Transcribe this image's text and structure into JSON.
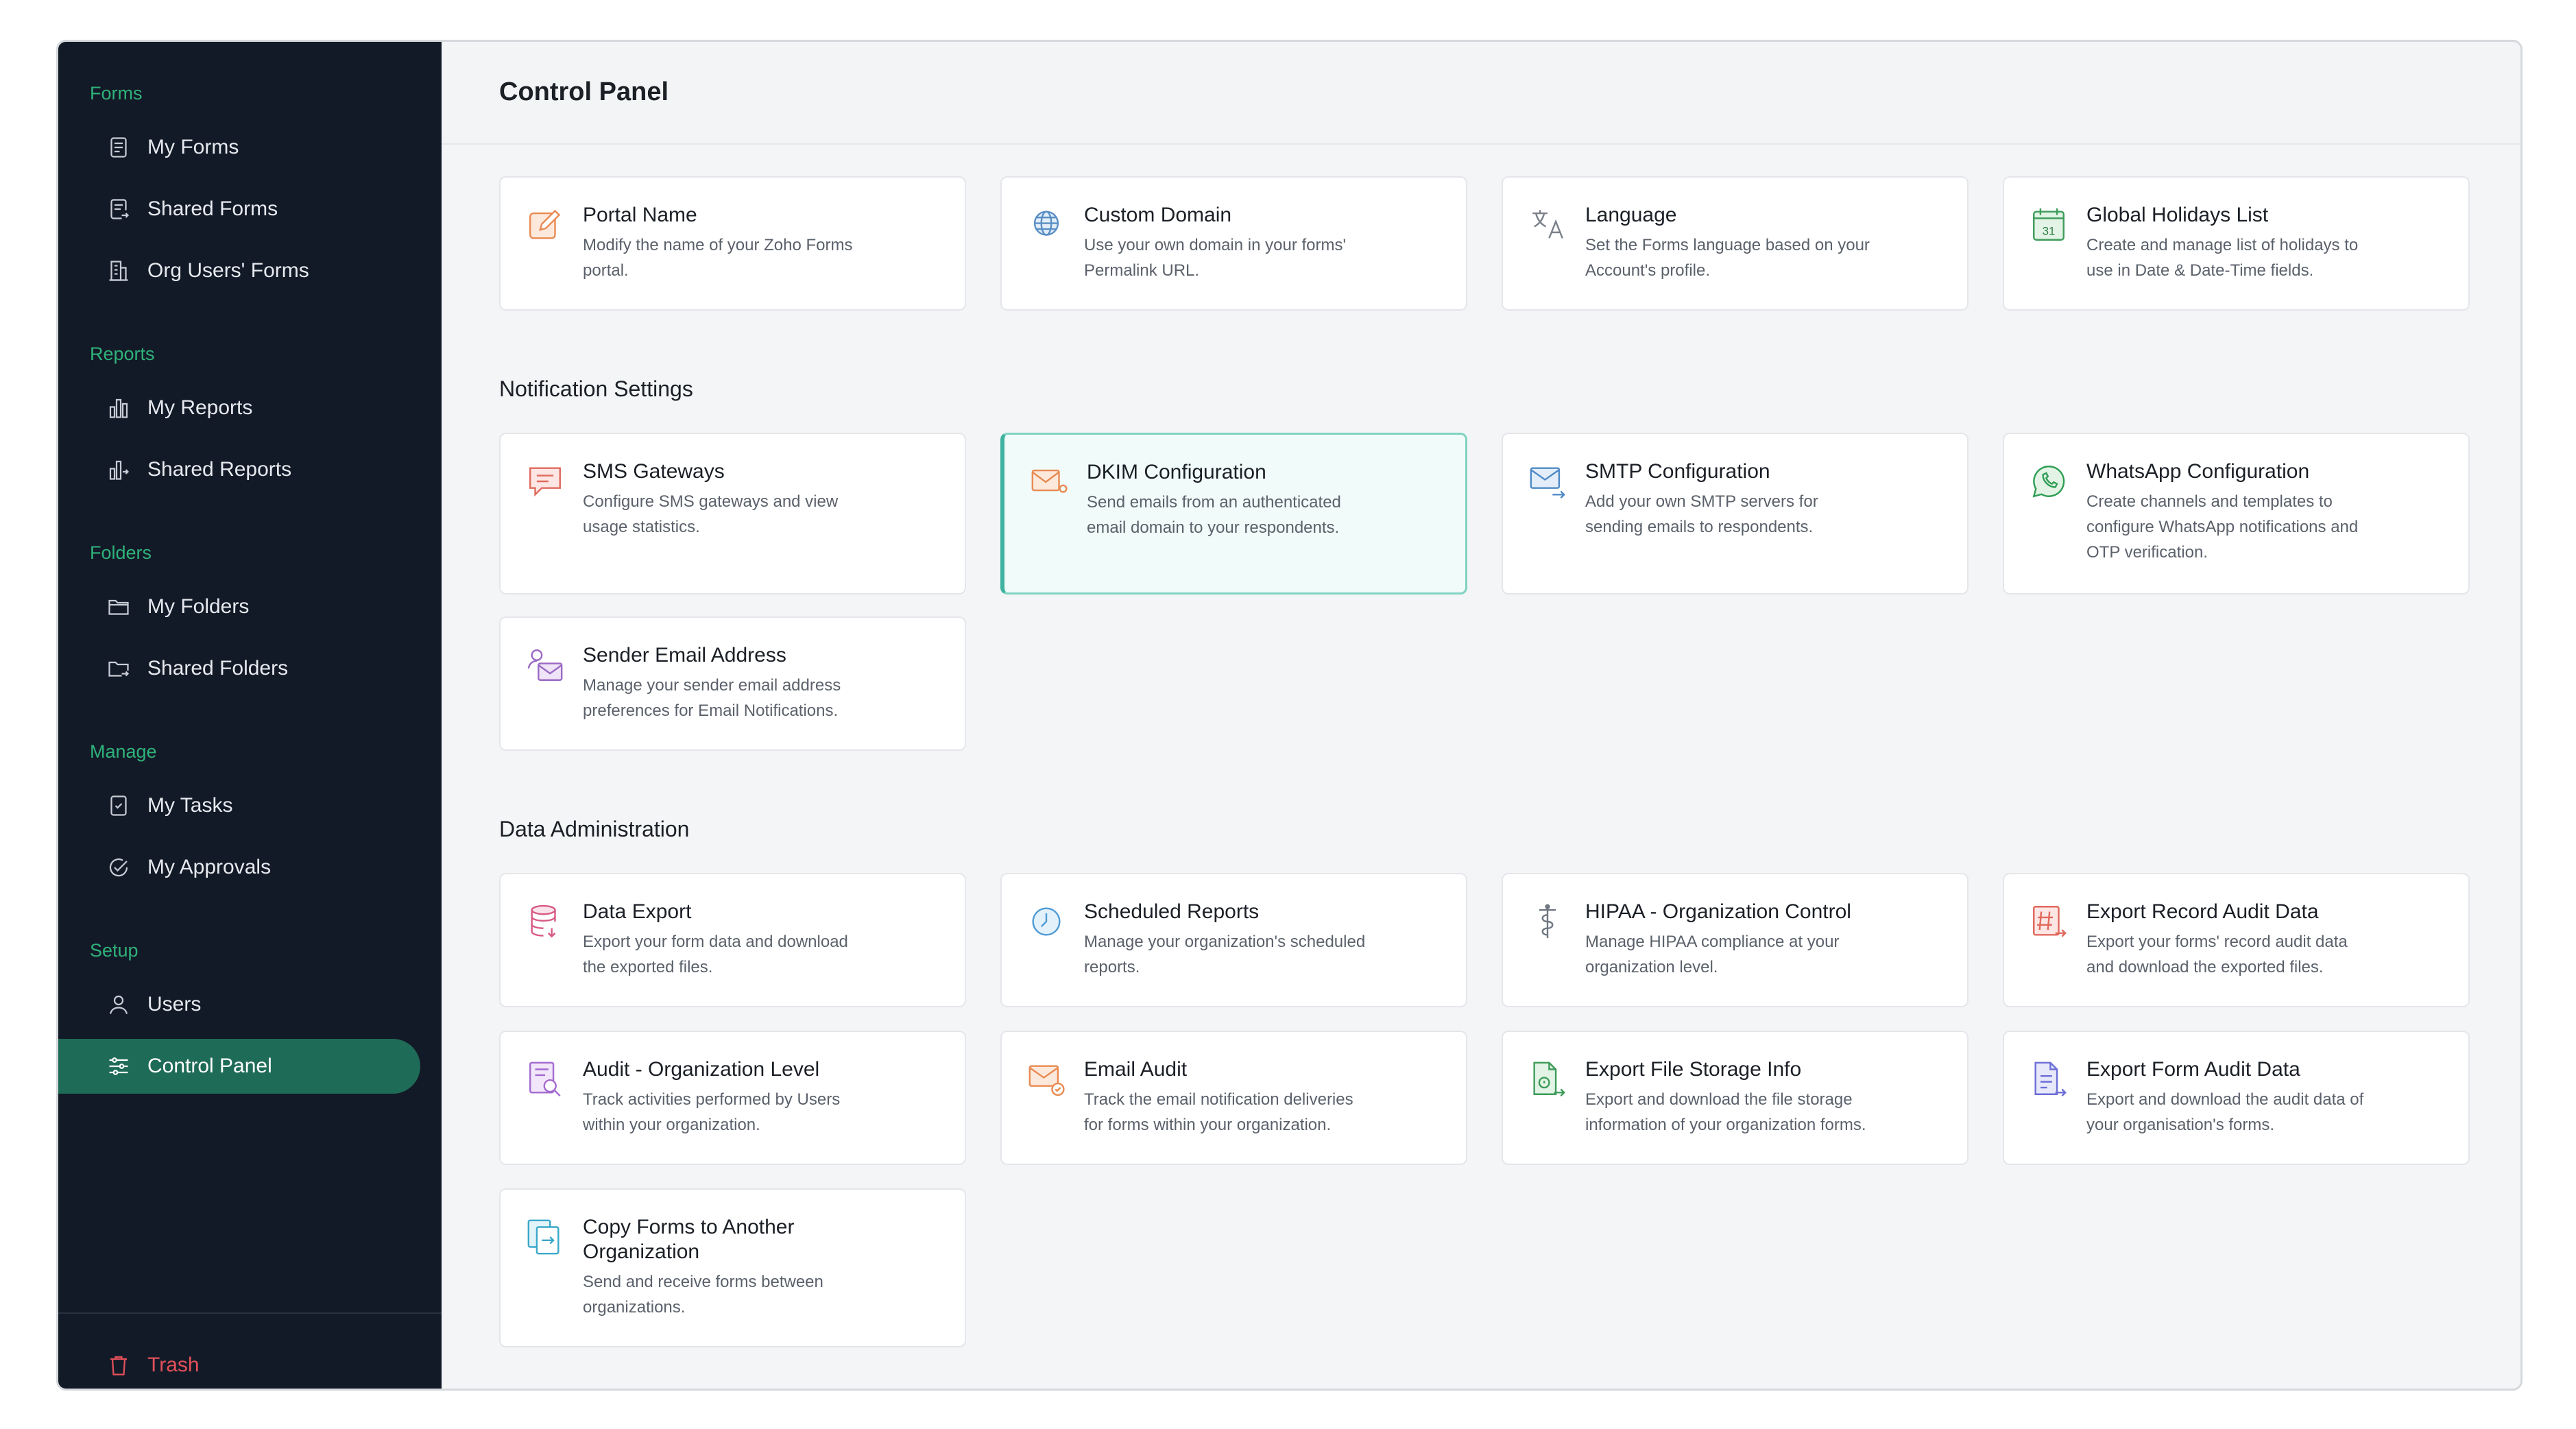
{
  "sidebar": {
    "groups": [
      {
        "title": "Forms",
        "items": [
          {
            "label": "My Forms"
          },
          {
            "label": "Shared Forms"
          },
          {
            "label": "Org Users' Forms"
          }
        ]
      },
      {
        "title": "Reports",
        "items": [
          {
            "label": "My Reports"
          },
          {
            "label": "Shared Reports"
          }
        ]
      },
      {
        "title": "Folders",
        "items": [
          {
            "label": "My Folders"
          },
          {
            "label": "Shared Folders"
          }
        ]
      },
      {
        "title": "Manage",
        "items": [
          {
            "label": "My Tasks"
          },
          {
            "label": "My Approvals"
          }
        ]
      },
      {
        "title": "Setup",
        "items": [
          {
            "label": "Users"
          },
          {
            "label": "Control Panel"
          }
        ]
      }
    ],
    "trash": "Trash"
  },
  "main": {
    "title": "Control Panel",
    "general": [
      {
        "title": "Portal Name",
        "desc": [
          "Modify the name of your Zoho Forms",
          "portal."
        ],
        "icon": "edit-icon"
      },
      {
        "title": "Custom Domain",
        "desc": [
          "Use your own domain in your forms'",
          "Permalink URL."
        ],
        "icon": "globe-icon"
      },
      {
        "title": "Language",
        "desc": [
          "Set the Forms language based on your",
          "Account's profile."
        ],
        "icon": "translate-icon"
      },
      {
        "title": "Global Holidays List",
        "desc": [
          "Create and manage list of holidays to",
          "use in Date & Date-Time fields."
        ],
        "icon": "calendar-icon",
        "badge": "31"
      }
    ],
    "notification_title": "Notification Settings",
    "notification": [
      {
        "title": "SMS Gateways",
        "desc": [
          "Configure SMS gateways and view",
          "usage statistics."
        ],
        "icon": "sms-icon"
      },
      {
        "title": "DKIM Configuration",
        "desc": [
          "Send emails from an authenticated",
          "email domain to your respondents."
        ],
        "icon": "dkim-mail-icon"
      },
      {
        "title": "SMTP Configuration",
        "desc": [
          "Add your own SMTP servers for",
          "sending emails to respondents."
        ],
        "icon": "smtp-mail-icon"
      },
      {
        "title": "WhatsApp Configuration",
        "desc": [
          "Create channels and templates to",
          "configure WhatsApp notifications and",
          "OTP verification."
        ],
        "icon": "whatsapp-icon"
      },
      {
        "title": "Sender Email Address",
        "desc": [
          "Manage your sender email address",
          "preferences for Email Notifications."
        ],
        "icon": "sender-mail-icon"
      }
    ],
    "data_title": "Data Administration",
    "data": [
      {
        "title": "Data Export",
        "desc": [
          "Export your form data and download",
          "the exported files."
        ],
        "icon": "database-icon"
      },
      {
        "title": "Scheduled Reports",
        "desc": [
          "Manage your organization's scheduled",
          "reports."
        ],
        "icon": "clock-icon"
      },
      {
        "title": "HIPAA - Organization Control",
        "desc": [
          "Manage HIPAA compliance at your",
          "organization level."
        ],
        "icon": "caduceus-icon"
      },
      {
        "title": "Export Record Audit Data",
        "desc": [
          "Export your forms' record audit data",
          "and download the exported files."
        ],
        "icon": "hash-export-icon"
      },
      {
        "title": "Audit - Organization Level",
        "desc": [
          "Track activities performed by Users",
          "within your organization."
        ],
        "icon": "audit-search-icon"
      },
      {
        "title": "Email Audit",
        "desc": [
          "Track the email notification deliveries",
          "for forms within your organization."
        ],
        "icon": "email-audit-icon"
      },
      {
        "title": "Export File Storage Info",
        "desc": [
          "Export and download the file storage",
          "information of your organization forms."
        ],
        "icon": "file-export-icon"
      },
      {
        "title": "Export Form Audit Data",
        "desc": [
          "Export and download the audit data of",
          "your organisation's forms."
        ],
        "icon": "form-export-icon"
      },
      {
        "title": "Copy Forms to Another Organization",
        "title_lines": [
          "Copy Forms to Another",
          "Organization"
        ],
        "desc": [
          "Send and receive forms between",
          "organizations."
        ],
        "icon": "copy-forms-icon"
      }
    ]
  },
  "colors": {
    "sidebar_bg": "#131a27",
    "accent_green": "#2fb27a",
    "active_bg": "#1e6b57",
    "trash_red": "#e2505a"
  }
}
